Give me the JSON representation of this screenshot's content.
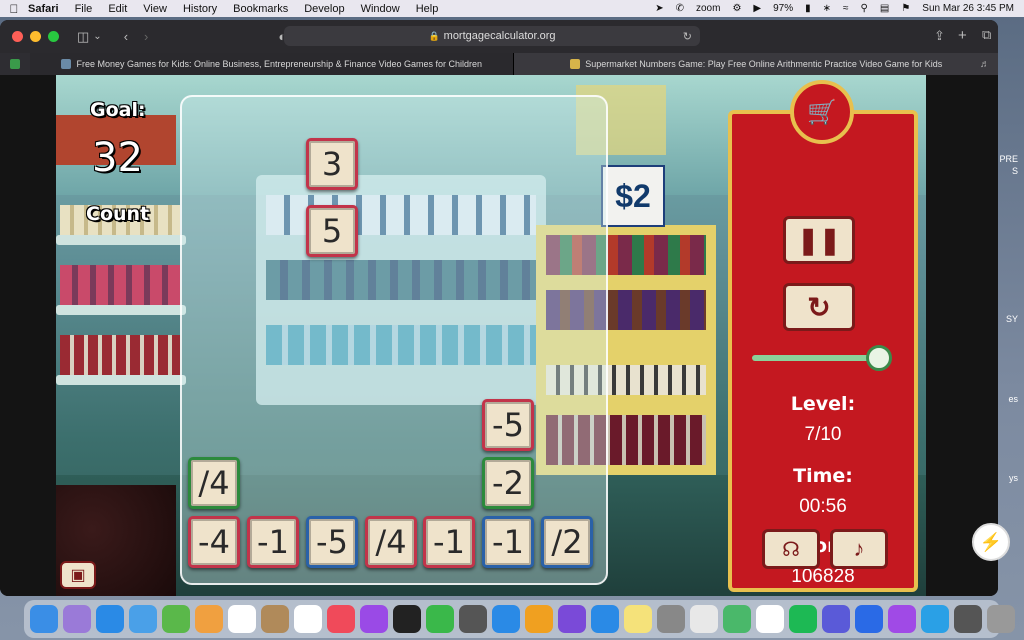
{
  "menubar": {
    "app": "Safari",
    "items": [
      "File",
      "Edit",
      "View",
      "History",
      "Bookmarks",
      "Develop",
      "Window",
      "Help"
    ],
    "status": {
      "zoom": "zoom",
      "battery": "97%",
      "datetime": "Sun Mar 26  3:45 PM"
    }
  },
  "browser": {
    "url": "mortgagecalculator.org",
    "tabs": [
      {
        "title": "Free Money Games for Kids: Online Business, Entrepreneurship & Finance Video Games for Children"
      },
      {
        "title": "Supermarket Numbers Game: Play Free Online Arithmentic Practice Video Game for Kids"
      }
    ]
  },
  "desktop_labels": [
    "PRE",
    "S",
    "SY",
    "es",
    "ys"
  ],
  "game": {
    "goal_label": "Goal:",
    "goal_value": "32",
    "count_label": "Count",
    "price_sign": "$2",
    "tiles": [
      {
        "text": "3",
        "color": "#c2344a"
      },
      {
        "text": "5",
        "color": "#c2344a"
      },
      {
        "text": "-5",
        "color": "#c2344a"
      },
      {
        "text": "/4",
        "color": "#2c8a3c"
      },
      {
        "text": "-2",
        "color": "#2c8a3c"
      },
      {
        "text": "-4",
        "color": "#c2344a"
      },
      {
        "text": "-1",
        "color": "#c2344a"
      },
      {
        "text": "-5",
        "color": "#2a61a8"
      },
      {
        "text": "/4",
        "color": "#c2344a"
      },
      {
        "text": "-1",
        "color": "#c2344a"
      },
      {
        "text": "-1",
        "color": "#2a61a8"
      },
      {
        "text": "/2",
        "color": "#2a61a8"
      }
    ],
    "panel": {
      "level_label": "Level:",
      "level_value": "7/10",
      "time_label": "Time:",
      "time_value": "00:56",
      "score_label": "Score:",
      "score_value": "106828"
    }
  },
  "colors": {
    "panel_red": "#c41820",
    "panel_gold": "#e8c04e",
    "tile_bg": "#efe3cb"
  }
}
